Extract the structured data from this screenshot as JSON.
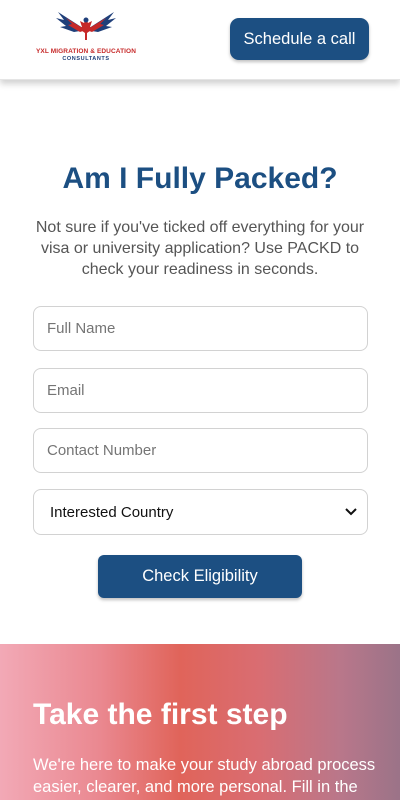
{
  "header": {
    "logo_line1": "YXL MIGRATION & EDUCATION",
    "logo_line2": "CONSULTANTS",
    "cta_label": "Schedule a call"
  },
  "hero": {
    "title": "Am I Fully Packed?",
    "subtitle": "Not sure if you've ticked off everything for your visa or university application? Use PACKD to check your readiness in seconds."
  },
  "form": {
    "full_name_placeholder": "Full Name",
    "full_name_value": "",
    "email_placeholder": "Email",
    "email_value": "",
    "contact_placeholder": "Contact Number",
    "contact_value": "",
    "country_selected": "Interested Country",
    "submit_label": "Check Eligibility"
  },
  "promo": {
    "title": "Take the first step",
    "text": "We're here to make your study abroad process easier, clearer, and more personal. Fill in the form below to book a free consultation."
  },
  "colors": {
    "brand_blue": "#1c4f82",
    "brand_red": "#c62828"
  },
  "icons": {
    "logo": "eagle-maple-leaf-logo",
    "select_arrow": "chevron-down-icon"
  }
}
